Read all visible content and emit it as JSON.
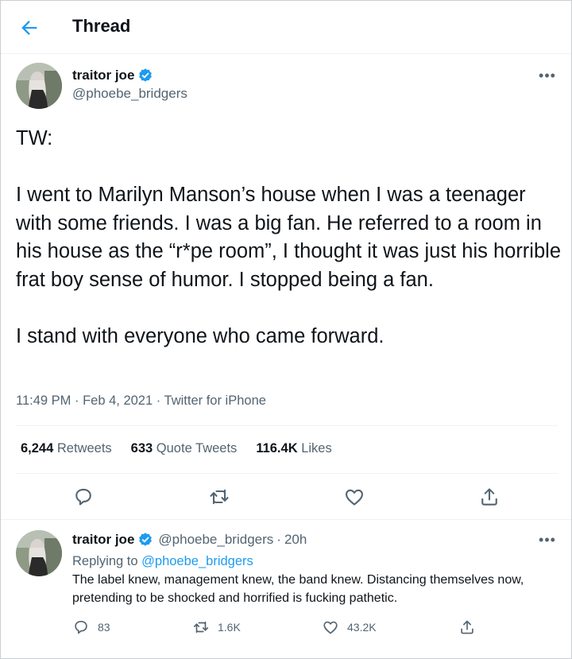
{
  "header": {
    "title": "Thread"
  },
  "tweet": {
    "author_name": "traitor joe",
    "author_handle": "@phoebe_bridgers",
    "body": "TW:\n\nI went to Marilyn Manson’s house when I was a teenager with some friends. I was a big fan. He referred to a room in his house as the “r*pe room”, I thought it was just his horrible frat boy sense of humor. I stopped being a fan.\n\nI stand with everyone who came forward.",
    "time": "11:49 PM",
    "date": "Feb 4, 2021",
    "source": "Twitter for iPhone",
    "stats": {
      "retweets_count": "6,244",
      "retweets_label": "Retweets",
      "quotes_count": "633",
      "quotes_label": "Quote Tweets",
      "likes_count": "116.4K",
      "likes_label": "Likes"
    }
  },
  "reply": {
    "author_name": "traitor joe",
    "author_handle": "@phoebe_bridgers",
    "age": "20h",
    "replying_prefix": "Replying to",
    "replying_to": "@phoebe_bridgers",
    "body": "The label knew, management knew, the band knew. Distancing themselves now, pretending to be shocked and horrified is fucking pathetic.",
    "counts": {
      "replies": "83",
      "retweets": "1.6K",
      "likes": "43.2K"
    }
  },
  "colors": {
    "accent": "#1d9bf0",
    "verified": "#1d9bf0",
    "muted": "#536471",
    "text": "#0f1419"
  },
  "icons": [
    "back-arrow-icon",
    "verified-badge-icon",
    "more-icon",
    "reply-icon",
    "retweet-icon",
    "like-icon",
    "share-icon"
  ]
}
